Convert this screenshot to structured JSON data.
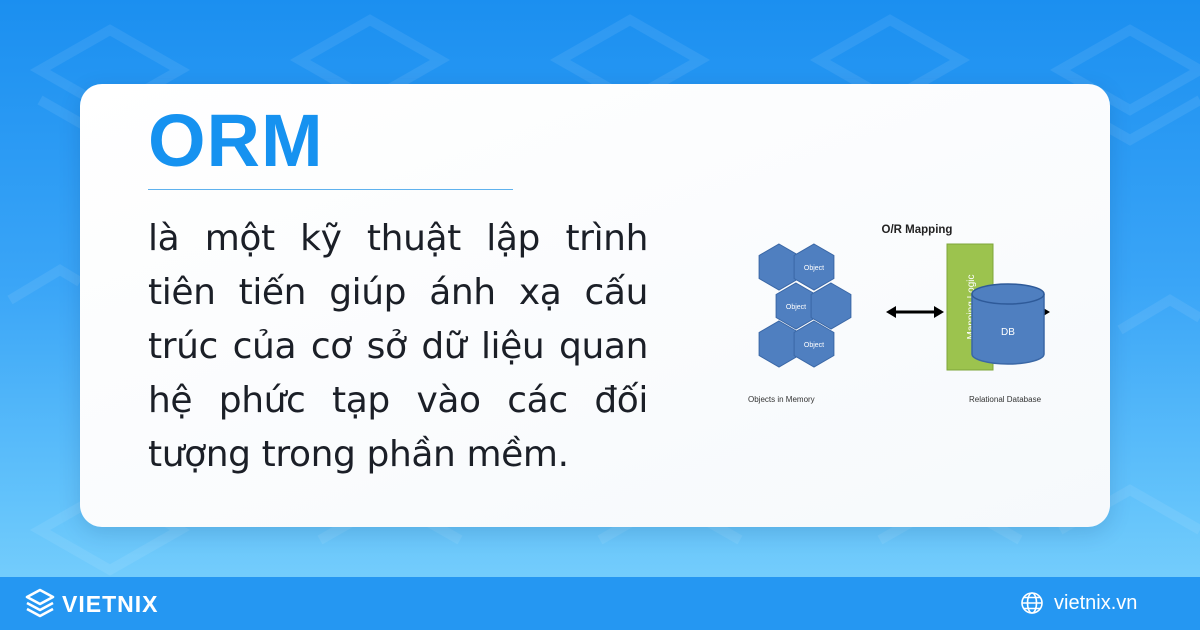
{
  "card": {
    "title": "ORM",
    "description": "là một kỹ thuật lập trình tiên tiến giúp ánh xạ cấu trúc của cơ sở dữ liệu quan hệ phức tạp vào các đối tượng trong phần mềm."
  },
  "diagram": {
    "title": "O/R Mapping",
    "object_label": "Object",
    "objects_caption": "Objects in Memory",
    "mapping_label": "Mapping Logic",
    "db_label": "DB",
    "db_caption": "Relational Database",
    "colors": {
      "hexagon": "#4f7fc0",
      "hexagon_stroke": "#3a67a6",
      "mapping": "#9cc34e",
      "mapping_stroke": "#7ea63a",
      "database": "#4f7fc0"
    }
  },
  "footer": {
    "brand": "VIETNIX",
    "website": "vietnix.vn",
    "logo_icon": "layers-logo-icon",
    "globe_icon": "globe-icon"
  },
  "colors": {
    "accent": "#1692f0",
    "footer": "#2597f2"
  }
}
